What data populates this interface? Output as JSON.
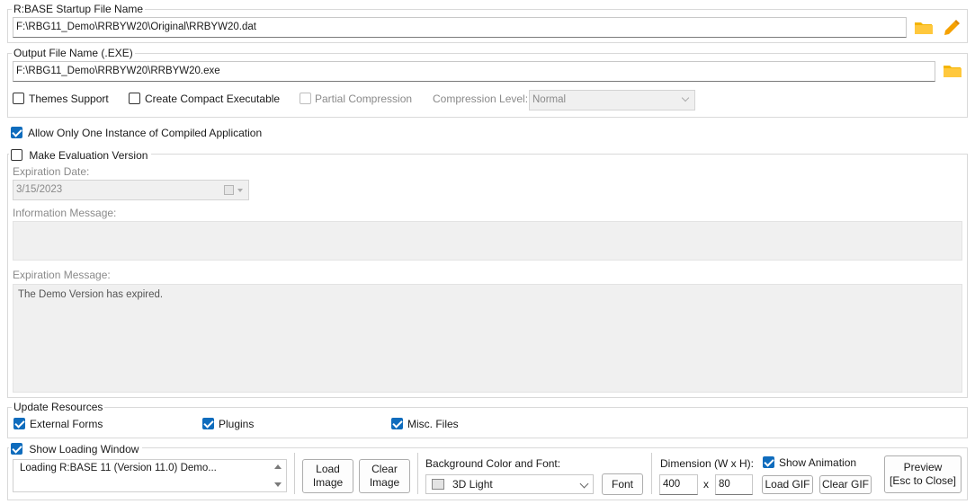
{
  "startup": {
    "legend": "R:BASE Startup File Name",
    "value": "F:\\RBG11_Demo\\RRBYW20\\Original\\RRBYW20.dat"
  },
  "output": {
    "legend": "Output File Name (.EXE)",
    "value": "F:\\RBG11_Demo\\RRBYW20\\RRBYW20.exe",
    "themes_label": "Themes Support",
    "compact_label": "Create Compact Executable",
    "partial_label": "Partial Compression",
    "level_label": "Compression Level:",
    "level_value": "Normal"
  },
  "single_instance": {
    "label": "Allow Only One Instance of Compiled Application",
    "checked": true
  },
  "evaluation": {
    "legend": "Make Evaluation Version",
    "expiration_date_label": "Expiration Date:",
    "expiration_date_value": "3/15/2023",
    "info_label": "Information Message:",
    "info_value": "",
    "expired_label": "Expiration Message:",
    "expired_value": "The Demo Version has expired."
  },
  "resources": {
    "legend": "Update Resources",
    "forms_label": "External Forms",
    "plugins_label": "Plugins",
    "misc_label": "Misc. Files"
  },
  "loading": {
    "legend": "Show Loading Window",
    "message": "Loading R:BASE 11 (Version 11.0) Demo...",
    "load_image": "Load\nImage",
    "clear_image": "Clear\nImage",
    "bg_label": "Background Color and Font:",
    "bg_value": "3D Light",
    "font_button": "Font",
    "dimension_label": "Dimension (W x H):",
    "width": "400",
    "x_sep": "x",
    "height": "80",
    "animation_label": "Show Animation",
    "load_gif": "Load GIF",
    "clear_gif": "Clear GIF",
    "preview": "Preview\n[Esc to Close]"
  },
  "colors": {
    "accent": "#0f6cbd",
    "folder": "#f4b400",
    "pencil": "#f5a100",
    "disabled_bg": "#f0f0f0"
  }
}
